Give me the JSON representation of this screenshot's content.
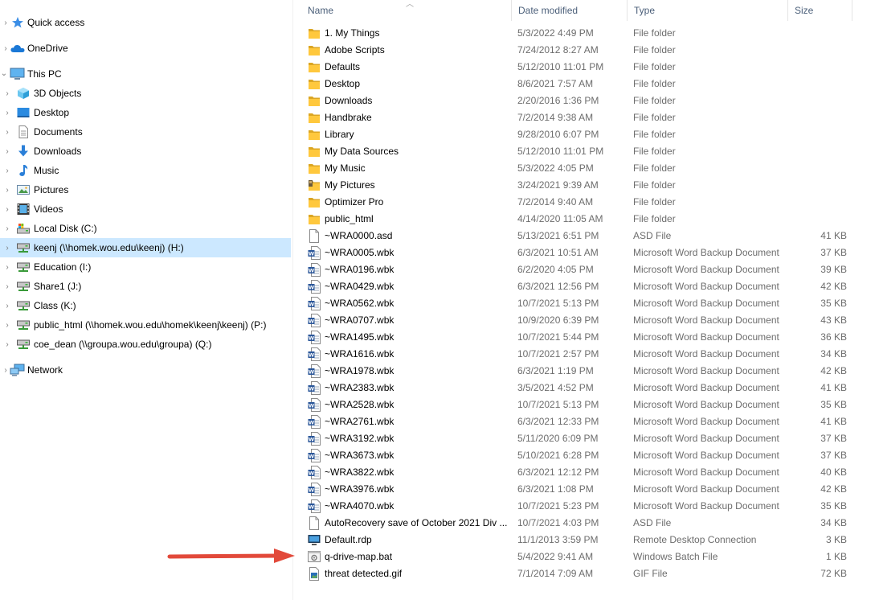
{
  "nav": {
    "quick_access": "Quick access",
    "onedrive": "OneDrive",
    "this_pc": "This PC",
    "items": [
      {
        "label": "3D Objects",
        "icon": "3d-objects-icon"
      },
      {
        "label": "Desktop",
        "icon": "desktop-icon"
      },
      {
        "label": "Documents",
        "icon": "documents-icon"
      },
      {
        "label": "Downloads",
        "icon": "downloads-icon"
      },
      {
        "label": "Music",
        "icon": "music-icon"
      },
      {
        "label": "Pictures",
        "icon": "pictures-icon"
      },
      {
        "label": "Videos",
        "icon": "videos-icon"
      },
      {
        "label": "Local Disk (C:)",
        "icon": "local-disk-icon"
      },
      {
        "label": "keenj (\\\\homek.wou.edu\\keenj) (H:)",
        "icon": "network-drive-icon",
        "selected": true
      },
      {
        "label": "Education (I:)",
        "icon": "network-drive-icon"
      },
      {
        "label": "Share1 (J:)",
        "icon": "network-drive-icon"
      },
      {
        "label": "Class (K:)",
        "icon": "network-drive-icon"
      },
      {
        "label": "public_html (\\\\homek.wou.edu\\homek\\keenj\\keenj) (P:)",
        "icon": "network-drive-icon"
      },
      {
        "label": "coe_dean (\\\\groupa.wou.edu\\groupa) (Q:)",
        "icon": "network-drive-icon"
      }
    ],
    "network": "Network"
  },
  "columns": {
    "name": "Name",
    "date": "Date modified",
    "type": "Type",
    "size": "Size"
  },
  "files": [
    {
      "name": "1. My Things",
      "date": "5/3/2022 4:49 PM",
      "type": "File folder",
      "size": "",
      "icon": "folder"
    },
    {
      "name": "Adobe Scripts",
      "date": "7/24/2012 8:27 AM",
      "type": "File folder",
      "size": "",
      "icon": "folder"
    },
    {
      "name": "Defaults",
      "date": "5/12/2010 11:01 PM",
      "type": "File folder",
      "size": "",
      "icon": "folder"
    },
    {
      "name": "Desktop",
      "date": "8/6/2021 7:57 AM",
      "type": "File folder",
      "size": "",
      "icon": "folder"
    },
    {
      "name": "Downloads",
      "date": "2/20/2016 1:36 PM",
      "type": "File folder",
      "size": "",
      "icon": "folder"
    },
    {
      "name": "Handbrake",
      "date": "7/2/2014 9:38 AM",
      "type": "File folder",
      "size": "",
      "icon": "folder"
    },
    {
      "name": "Library",
      "date": "9/28/2010 6:07 PM",
      "type": "File folder",
      "size": "",
      "icon": "folder"
    },
    {
      "name": "My Data Sources",
      "date": "5/12/2010 11:01 PM",
      "type": "File folder",
      "size": "",
      "icon": "folder"
    },
    {
      "name": "My Music",
      "date": "5/3/2022 4:05 PM",
      "type": "File folder",
      "size": "",
      "icon": "folder"
    },
    {
      "name": "My Pictures",
      "date": "3/24/2021 9:39 AM",
      "type": "File folder",
      "size": "",
      "icon": "folder-locked"
    },
    {
      "name": "Optimizer Pro",
      "date": "7/2/2014 9:40 AM",
      "type": "File folder",
      "size": "",
      "icon": "folder"
    },
    {
      "name": "public_html",
      "date": "4/14/2020 11:05 AM",
      "type": "File folder",
      "size": "",
      "icon": "folder"
    },
    {
      "name": "~WRA0000.asd",
      "date": "5/13/2021 6:51 PM",
      "type": "ASD File",
      "size": "41 KB",
      "icon": "blank"
    },
    {
      "name": "~WRA0005.wbk",
      "date": "6/3/2021 10:51 AM",
      "type": "Microsoft Word Backup Document",
      "size": "37 KB",
      "icon": "word"
    },
    {
      "name": "~WRA0196.wbk",
      "date": "6/2/2020 4:05 PM",
      "type": "Microsoft Word Backup Document",
      "size": "39 KB",
      "icon": "word"
    },
    {
      "name": "~WRA0429.wbk",
      "date": "6/3/2021 12:56 PM",
      "type": "Microsoft Word Backup Document",
      "size": "42 KB",
      "icon": "word"
    },
    {
      "name": "~WRA0562.wbk",
      "date": "10/7/2021 5:13 PM",
      "type": "Microsoft Word Backup Document",
      "size": "35 KB",
      "icon": "word"
    },
    {
      "name": "~WRA0707.wbk",
      "date": "10/9/2020 6:39 PM",
      "type": "Microsoft Word Backup Document",
      "size": "43 KB",
      "icon": "word"
    },
    {
      "name": "~WRA1495.wbk",
      "date": "10/7/2021 5:44 PM",
      "type": "Microsoft Word Backup Document",
      "size": "36 KB",
      "icon": "word"
    },
    {
      "name": "~WRA1616.wbk",
      "date": "10/7/2021 2:57 PM",
      "type": "Microsoft Word Backup Document",
      "size": "34 KB",
      "icon": "word"
    },
    {
      "name": "~WRA1978.wbk",
      "date": "6/3/2021 1:19 PM",
      "type": "Microsoft Word Backup Document",
      "size": "42 KB",
      "icon": "word"
    },
    {
      "name": "~WRA2383.wbk",
      "date": "3/5/2021 4:52 PM",
      "type": "Microsoft Word Backup Document",
      "size": "41 KB",
      "icon": "word"
    },
    {
      "name": "~WRA2528.wbk",
      "date": "10/7/2021 5:13 PM",
      "type": "Microsoft Word Backup Document",
      "size": "35 KB",
      "icon": "word"
    },
    {
      "name": "~WRA2761.wbk",
      "date": "6/3/2021 12:33 PM",
      "type": "Microsoft Word Backup Document",
      "size": "41 KB",
      "icon": "word"
    },
    {
      "name": "~WRA3192.wbk",
      "date": "5/11/2020 6:09 PM",
      "type": "Microsoft Word Backup Document",
      "size": "37 KB",
      "icon": "word"
    },
    {
      "name": "~WRA3673.wbk",
      "date": "5/10/2021 6:28 PM",
      "type": "Microsoft Word Backup Document",
      "size": "37 KB",
      "icon": "word"
    },
    {
      "name": "~WRA3822.wbk",
      "date": "6/3/2021 12:12 PM",
      "type": "Microsoft Word Backup Document",
      "size": "40 KB",
      "icon": "word"
    },
    {
      "name": "~WRA3976.wbk",
      "date": "6/3/2021 1:08 PM",
      "type": "Microsoft Word Backup Document",
      "size": "42 KB",
      "icon": "word"
    },
    {
      "name": "~WRA4070.wbk",
      "date": "10/7/2021 5:23 PM",
      "type": "Microsoft Word Backup Document",
      "size": "35 KB",
      "icon": "word"
    },
    {
      "name": "AutoRecovery save of October 2021 Div ...",
      "date": "10/7/2021 4:03 PM",
      "type": "ASD File",
      "size": "34 KB",
      "icon": "blank"
    },
    {
      "name": "Default.rdp",
      "date": "11/1/2013 3:59 PM",
      "type": "Remote Desktop Connection",
      "size": "3 KB",
      "icon": "rdp"
    },
    {
      "name": "q-drive-map.bat",
      "date": "5/4/2022 9:41 AM",
      "type": "Windows Batch File",
      "size": "1 KB",
      "icon": "bat"
    },
    {
      "name": "threat detected.gif",
      "date": "7/1/2014 7:09 AM",
      "type": "GIF File",
      "size": "72 KB",
      "icon": "gif"
    }
  ],
  "colors": {
    "selection": "#cce8ff",
    "folder": "#ffc83d",
    "arrow": "#e2493a",
    "word": "#2b579a"
  }
}
